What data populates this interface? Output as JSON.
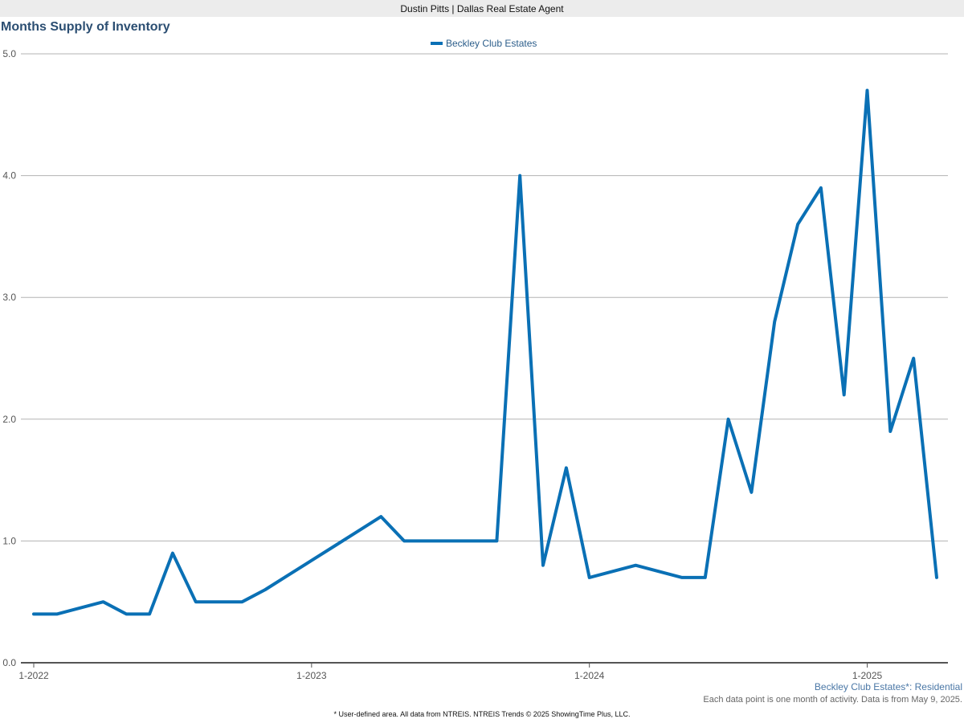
{
  "header": {
    "agent": "Dustin Pitts | Dallas Real Estate Agent"
  },
  "footer": {
    "series_label": "Beckley Club Estates*: Residential",
    "note": "Each data point is one month of activity. Data is from May 9, 2025.",
    "source": "* User-defined area. All data from NTREIS. NTREIS Trends © 2025 ShowingTime Plus, LLC."
  },
  "colors": {
    "series": "#0a70b5",
    "grid": "#b3b3b3",
    "axis": "#555555",
    "title": "#2b4e72"
  },
  "chart_data": {
    "type": "line",
    "title": "Months Supply of Inventory",
    "xlabel": "",
    "ylabel": "",
    "ylim": [
      0,
      5
    ],
    "yticks": [
      0.0,
      1.0,
      2.0,
      3.0,
      4.0,
      5.0
    ],
    "ytick_labels": [
      "0.0",
      "1.0",
      "2.0",
      "3.0",
      "4.0",
      "5.0"
    ],
    "xticks": [
      "1-2022",
      "1-2023",
      "1-2024",
      "1-2025"
    ],
    "grid": true,
    "legend": "top-center",
    "x": [
      "2022-01",
      "2022-02",
      "2022-03",
      "2022-04",
      "2022-05",
      "2022-06",
      "2022-07",
      "2022-08",
      "2022-09",
      "2022-10",
      "2022-11",
      "2022-12",
      "2023-01",
      "2023-02",
      "2023-03",
      "2023-04",
      "2023-05",
      "2023-06",
      "2023-07",
      "2023-08",
      "2023-09",
      "2023-10",
      "2023-11",
      "2023-12",
      "2024-01",
      "2024-02",
      "2024-03",
      "2024-04",
      "2024-05",
      "2024-06",
      "2024-07",
      "2024-08",
      "2024-09",
      "2024-10",
      "2024-11",
      "2024-12",
      "2025-01",
      "2025-02",
      "2025-03",
      "2025-04"
    ],
    "series": [
      {
        "name": "Beckley Club Estates",
        "values": [
          0.4,
          0.4,
          0.45,
          0.5,
          0.4,
          0.4,
          0.9,
          0.5,
          0.5,
          0.5,
          0.6,
          0.72,
          0.84,
          0.96,
          1.08,
          1.2,
          1.0,
          1.0,
          1.0,
          1.0,
          1.0,
          4.0,
          0.8,
          1.6,
          0.7,
          0.75,
          0.8,
          0.75,
          0.7,
          0.7,
          2.0,
          1.4,
          2.8,
          3.6,
          3.9,
          2.2,
          4.7,
          1.9,
          2.5,
          0.7
        ]
      }
    ]
  }
}
